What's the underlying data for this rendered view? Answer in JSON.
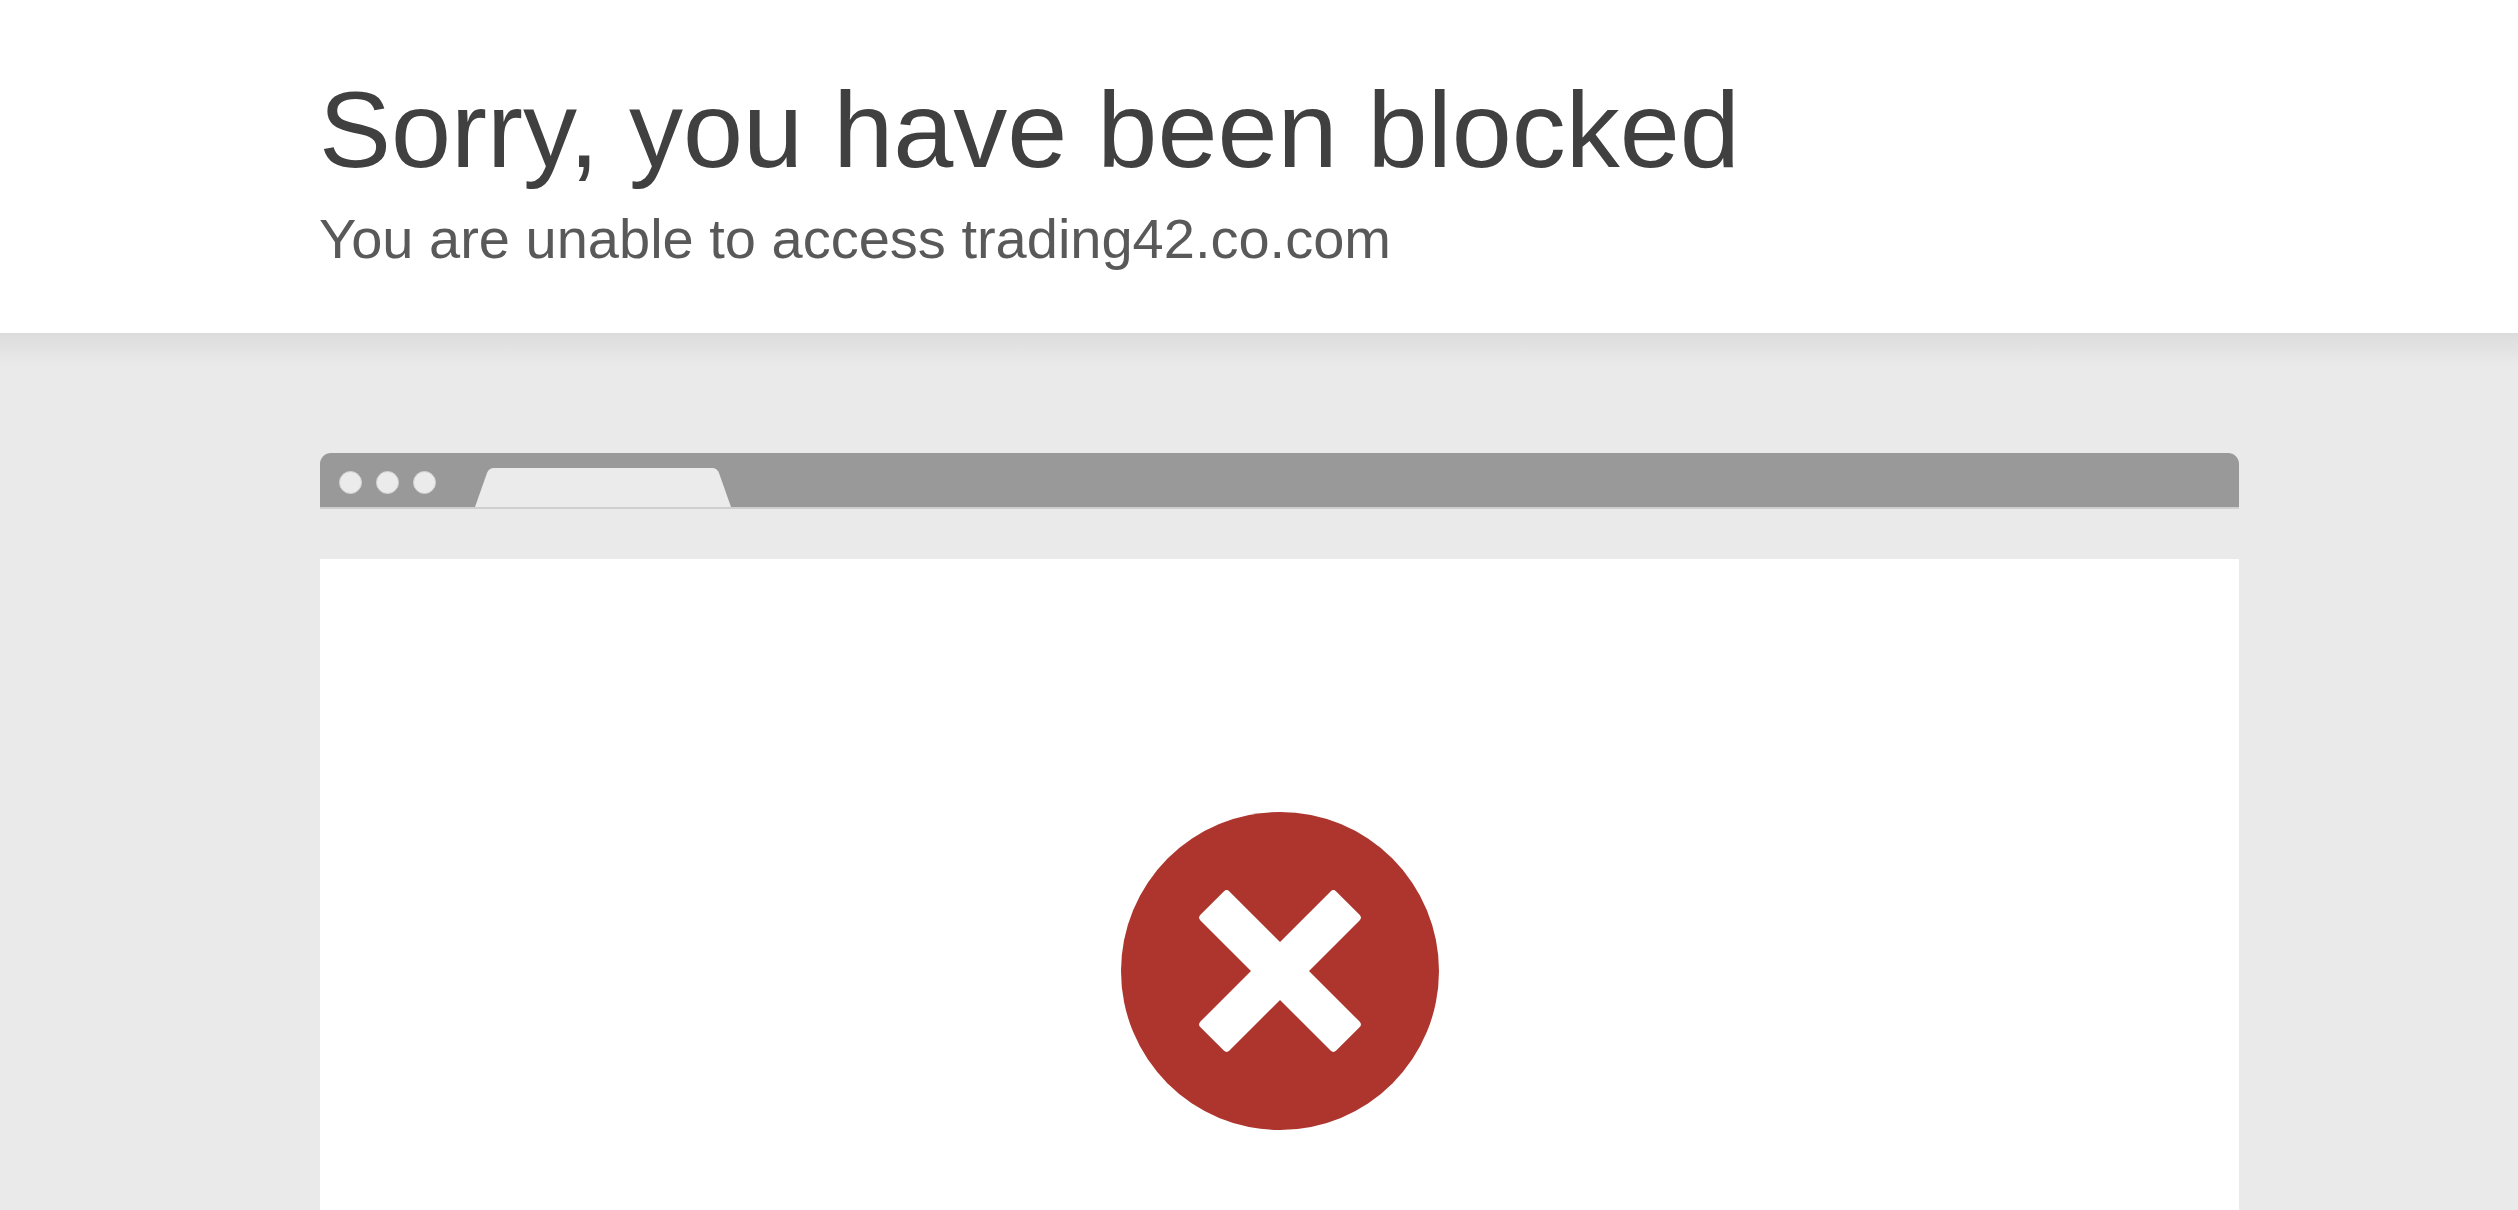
{
  "header": {
    "title": "Sorry, you have been blocked",
    "subtitle": "You are unable to access trading42.co.com"
  }
}
